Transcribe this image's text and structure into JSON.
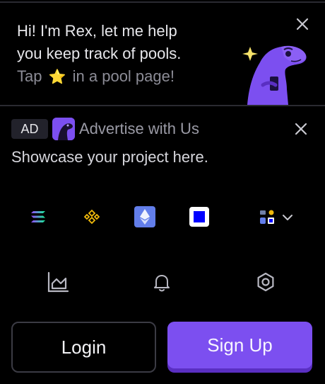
{
  "rex": {
    "line1": "Hi! I'm Rex, let me help",
    "line2": "you keep track of pools.",
    "line3_before": "Tap",
    "line3_after": "in a pool page!",
    "star": "⭐"
  },
  "ad": {
    "badge": "AD",
    "title": "Advertise with Us",
    "subtitle": "Showcase your project here."
  },
  "chains": [
    "solana-icon",
    "bnb-chain-icon",
    "ethereum-icon",
    "base-icon",
    "more-chains-icon"
  ],
  "nav": [
    "chart-icon",
    "bell-icon",
    "settings-icon"
  ],
  "buttons": {
    "login": "Login",
    "signup": "Sign Up"
  },
  "colors": {
    "accent": "#7c4ff0",
    "accent_dark": "#5a2fc2",
    "background": "#000000"
  }
}
